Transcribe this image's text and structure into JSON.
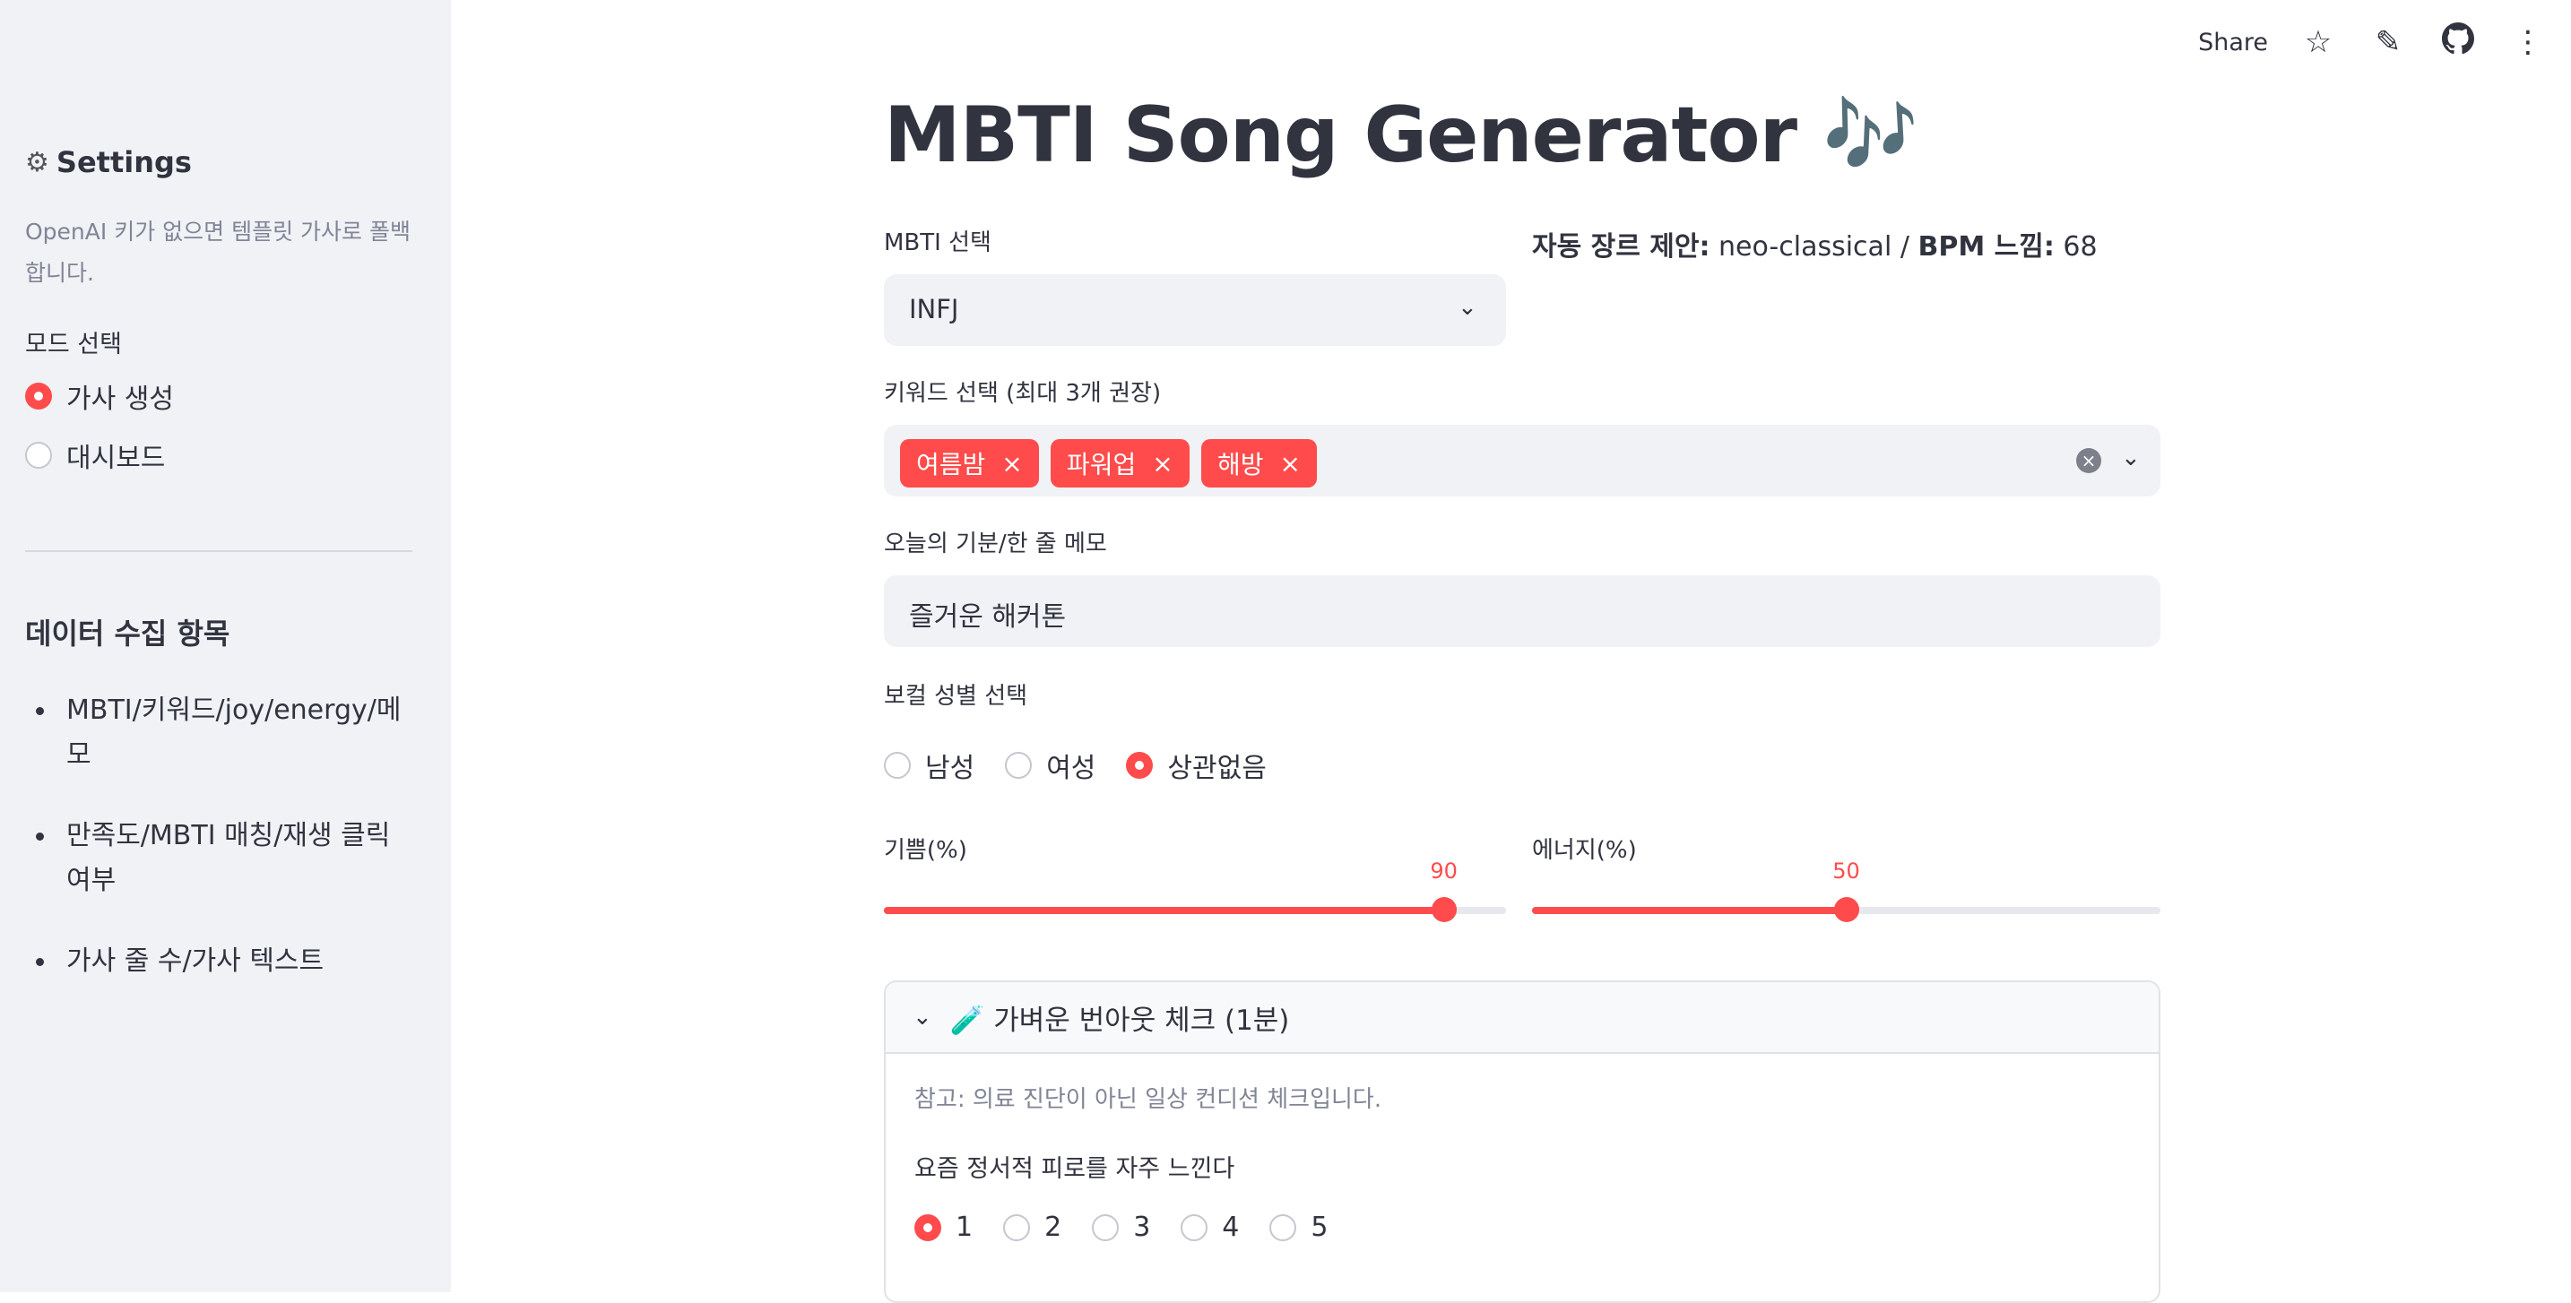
{
  "toolbar": {
    "share_label": "Share",
    "icons": [
      "star-icon",
      "edit-pencil-icon",
      "github-icon",
      "more-vertical-icon"
    ]
  },
  "sidebar": {
    "title": "Settings",
    "caption": "OpenAI 키가 없으면 템플릿 가사로 폴백합니다.",
    "mode_label": "모드 선택",
    "mode_options": [
      "가사 생성",
      "대시보드"
    ],
    "mode_selected": "가사 생성",
    "data_heading": "데이터 수집 항목",
    "data_items": [
      "MBTI/키워드/joy/energy/메모",
      "만족도/MBTI 매칭/재생 클릭 여부",
      "가사 줄 수/가사 텍스트"
    ]
  },
  "main": {
    "title": "MBTI Song Generator 🎶",
    "mbti_label": "MBTI 선택",
    "mbti_value": "INFJ",
    "genre_prefix": "자동 장르 제안:",
    "genre_value": "neo-classical",
    "genre_sep": "/",
    "bpm_prefix": "BPM 느낌:",
    "bpm_value": "68",
    "keywords_label": "키워드 선택 (최대 3개 권장)",
    "keywords": [
      "여름밤",
      "파워업",
      "해방"
    ],
    "memo_label": "오늘의 기분/한 줄 메모",
    "memo_value": "즐거운 해커톤",
    "vocal_label": "보컬 성별 선택",
    "vocal_options": [
      "남성",
      "여성",
      "상관없음"
    ],
    "vocal_selected": "상관없음",
    "joy_label": "기쁨(%)",
    "joy_value": 90,
    "energy_label": "에너지(%)",
    "energy_value": 50,
    "expander": {
      "title": "🧪 가벼운 번아웃 체크 (1분)",
      "caption": "참고: 의료 진단이 아닌 일상 컨디션 체크입니다.",
      "question": "요즘 정서적 피로를 자주 느낀다",
      "options": [
        "1",
        "2",
        "3",
        "4",
        "5"
      ],
      "selected": "1"
    }
  },
  "colors": {
    "accent": "#ff4b4b",
    "sidebar_bg": "#f0f2f6",
    "text": "#31333f",
    "muted": "#808495"
  }
}
